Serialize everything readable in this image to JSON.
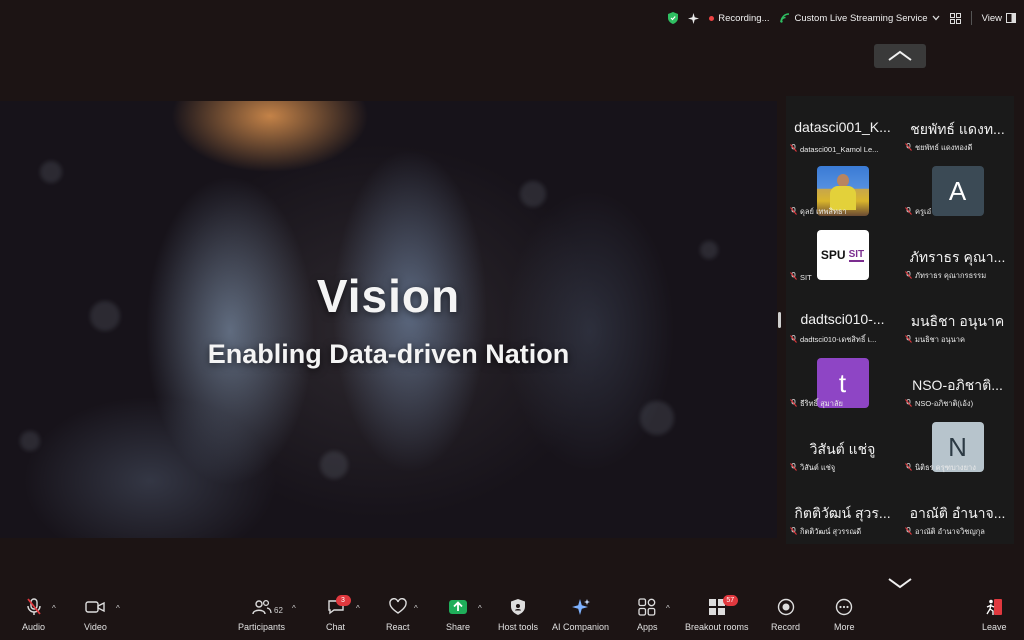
{
  "topbar": {
    "recording_label": "Recording...",
    "stream_label": "Custom Live Streaming Service",
    "view_label": "View"
  },
  "screen": {
    "title": "Vision",
    "subtitle": "Enabling Data-driven Nation"
  },
  "gallery": {
    "tiles": [
      {
        "name": "datasci001_K...",
        "label": "datasci001_Kamol Le..."
      },
      {
        "name": "ชยพัทธ์ แดงท...",
        "label": "ชยพัทธ์ แดงทองดี"
      },
      {
        "name": "",
        "label": "ดุลย์ เทพสิทธา",
        "avatar": "photo"
      },
      {
        "name": "",
        "label": "ครูเอ๋",
        "avatar": "letter",
        "letter": "A"
      },
      {
        "name": "",
        "label": "SIT",
        "avatar": "logo",
        "logo_left": "SPU",
        "logo_right": "SIT"
      },
      {
        "name": "ภัทราธร คุณา...",
        "label": "ภัทราธร คุณากรธรรม"
      },
      {
        "name": "dadtsci010-...",
        "label": "dadtsci010-เดชสิทธิ์ เ..."
      },
      {
        "name": "มนธิชา อนุนาค",
        "label": "มนธิชา อนุนาค"
      },
      {
        "name": "",
        "label": "ธีริทธิ์ สุมาลัย",
        "avatar": "letter",
        "letter": "t"
      },
      {
        "name": "NSO-อภิชาติ...",
        "label": "NSO-อภิชาติ(เอ้ง)"
      },
      {
        "name": "วิสันต์ แช่จู",
        "label": "วิสันต์ แช่จู"
      },
      {
        "name": "",
        "label": "นิติธร ครุฑบางยาง",
        "avatar": "letter",
        "letter": "N"
      },
      {
        "name": "กิตติวัฒน์ สุวร...",
        "label": "กิตติวัฒน์ สุวรรณดี"
      },
      {
        "name": "อาณัติ อำนาจ...",
        "label": "อาณัติ อำนาจวิชญกุล"
      }
    ]
  },
  "toolbar": {
    "audio": "Audio",
    "video": "Video",
    "participants": "Participants",
    "participants_count": "62",
    "chat": "Chat",
    "chat_badge": "3",
    "react": "React",
    "share": "Share",
    "host_tools": "Host tools",
    "ai_companion": "AI Companion",
    "apps": "Apps",
    "breakout_rooms": "Breakout rooms",
    "breakout_badge": "57",
    "record": "Record",
    "more": "More",
    "leave": "Leave"
  },
  "colors": {
    "background": "#1c1414",
    "share_green": "#1fae5a",
    "recording_red": "#e44444",
    "leave_red": "#e0383e",
    "badge_red": "#e0383e"
  }
}
